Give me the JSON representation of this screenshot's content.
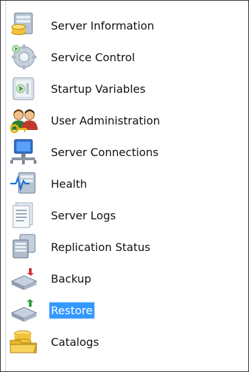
{
  "sidebar": {
    "items": [
      {
        "label": "Server Information",
        "icon": "database-server-icon"
      },
      {
        "label": "Service Control",
        "icon": "service-gear-icon"
      },
      {
        "label": "Startup Variables",
        "icon": "startup-variables-icon"
      },
      {
        "label": "User Administration",
        "icon": "users-key-icon"
      },
      {
        "label": "Server Connections",
        "icon": "network-connections-icon"
      },
      {
        "label": "Health",
        "icon": "health-monitor-icon"
      },
      {
        "label": "Server Logs",
        "icon": "logs-document-icon"
      },
      {
        "label": "Replication Status",
        "icon": "replication-servers-icon"
      },
      {
        "label": "Backup",
        "icon": "backup-drive-icon"
      },
      {
        "label": "Restore",
        "icon": "restore-drive-icon"
      },
      {
        "label": "Catalogs",
        "icon": "catalogs-folder-icon"
      }
    ],
    "selected": "Restore"
  },
  "colors": {
    "selection_bg": "#3399ff",
    "selection_text": "#ffffff",
    "border": "#2b2b2b"
  }
}
